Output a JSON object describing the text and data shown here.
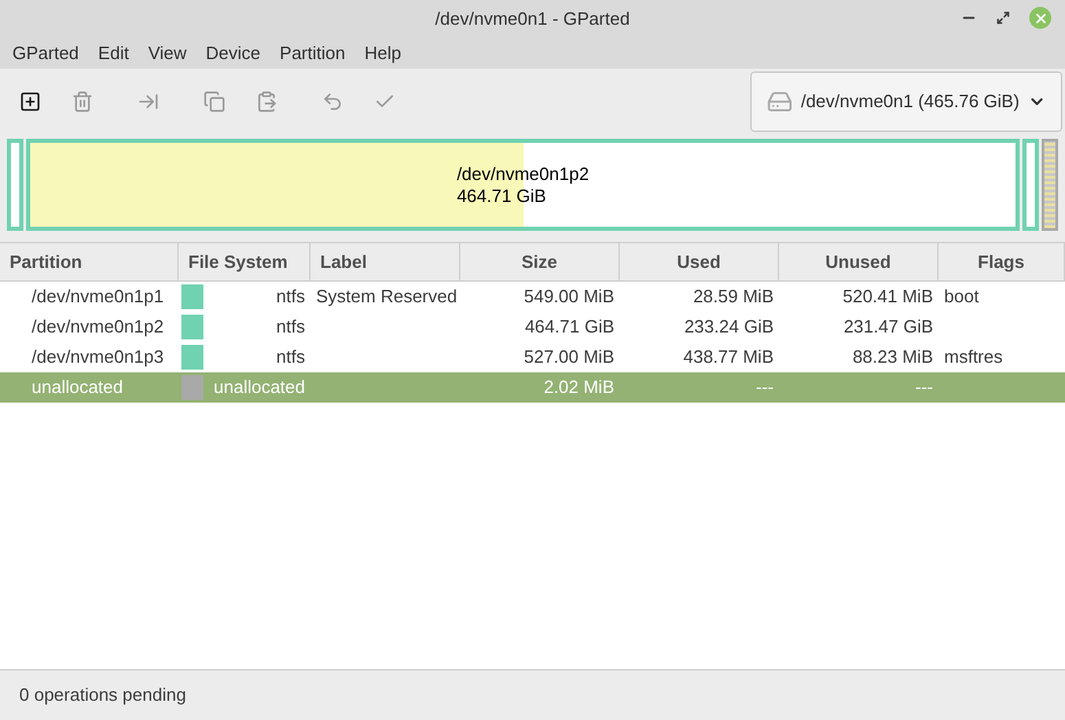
{
  "window": {
    "title": "/dev/nvme0n1 - GParted"
  },
  "menu": [
    "GParted",
    "Edit",
    "View",
    "Device",
    "Partition",
    "Help"
  ],
  "toolbar": [
    {
      "kind": "new",
      "disabled": false
    },
    {
      "kind": "delete",
      "disabled": true
    },
    {
      "kind": "resize",
      "disabled": true
    },
    {
      "kind": "copy",
      "disabled": true
    },
    {
      "kind": "paste",
      "disabled": true
    },
    {
      "kind": "undo",
      "disabled": true
    },
    {
      "kind": "apply",
      "disabled": true
    }
  ],
  "device_selector": {
    "value": "/dev/nvme0n1 (465.76 GiB)"
  },
  "disk_map": [
    {
      "kind": "partition"
    },
    {
      "kind": "partition",
      "level": 0.5,
      "name": "/dev/nvme0n1p2",
      "size": "464.71 GiB"
    },
    {
      "kind": "partition"
    },
    {
      "kind": "unallocated"
    }
  ],
  "table": {
    "columns": [
      "Partition",
      "File System",
      "Label",
      "Size",
      "Used",
      "Unused",
      "Flags"
    ],
    "rows": [
      {
        "partition": "/dev/nvme0n1p1",
        "color": "#70d2b0",
        "file_system": "ntfs",
        "label": "System Reserved",
        "size": "549.00 MiB",
        "used": "28.59 MiB",
        "unused": "520.41 MiB",
        "flags": "boot",
        "selected": false
      },
      {
        "partition": "/dev/nvme0n1p2",
        "color": "#70d2b0",
        "file_system": "ntfs",
        "size": "464.71 GiB",
        "used": "233.24 GiB",
        "unused": "231.47 GiB",
        "selected": false
      },
      {
        "partition": "/dev/nvme0n1p3",
        "color": "#70d2b0",
        "file_system": "ntfs",
        "size": "527.00 MiB",
        "used": "438.77 MiB",
        "unused": "88.23 MiB",
        "flags": "msftres",
        "selected": false
      },
      {
        "partition": "unallocated",
        "color": "#a9a9a9",
        "file_system": "unallocated",
        "size": "2.02 MiB",
        "used": "---",
        "unused": "---",
        "selected": true
      }
    ]
  },
  "status_bar": "0 operations pending"
}
